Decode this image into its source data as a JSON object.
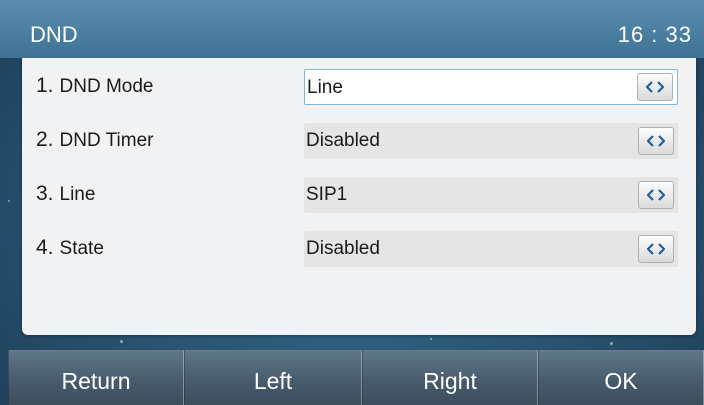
{
  "header": {
    "title": "DND",
    "time": "16 : 33"
  },
  "settings": [
    {
      "number": "1.",
      "label": "DND Mode",
      "value": "Line"
    },
    {
      "number": "2.",
      "label": "DND Timer",
      "value": "Disabled"
    },
    {
      "number": "3.",
      "label": "Line",
      "value": "SIP1"
    },
    {
      "number": "4.",
      "label": "State",
      "value": "Disabled"
    }
  ],
  "softkeys": {
    "return_label": "Return",
    "left_label": "Left",
    "right_label": "Right",
    "ok_label": "OK"
  },
  "colors": {
    "focus_border": "#7fb5e0",
    "arrow_icon": "#1f5f9e"
  },
  "icons": {
    "selector": "left-right-arrow-icon"
  }
}
